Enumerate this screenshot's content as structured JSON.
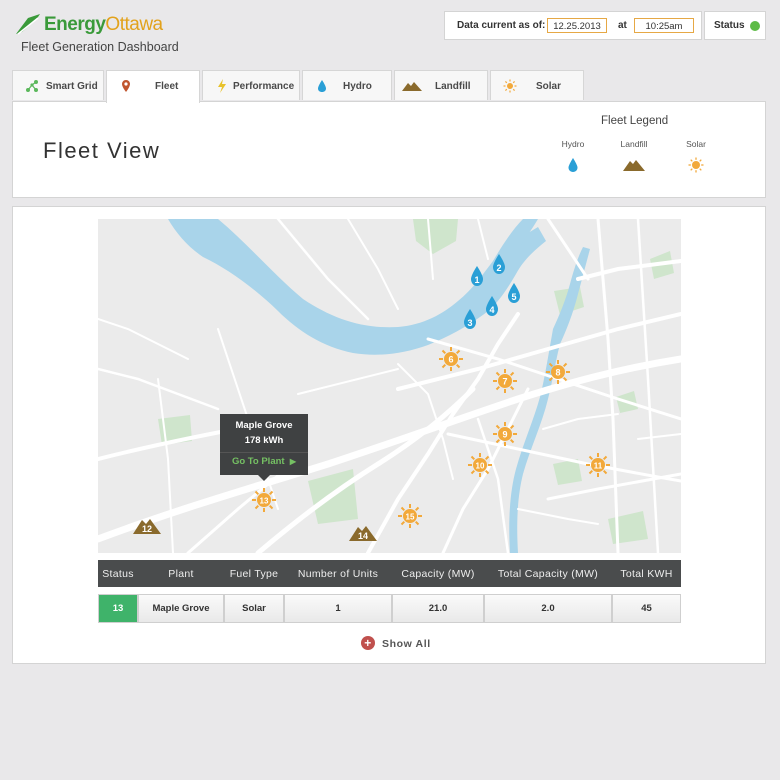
{
  "brand": {
    "name_part1": "Energy",
    "name_part2": "Ottawa",
    "subtitle": "Fleet Generation Dashboard"
  },
  "header": {
    "data_current_label": "Data current as of:",
    "date": "12.25.2013",
    "at_label": "at",
    "time": "10:25am",
    "status_label": "Status",
    "status_color": "#5dbb46"
  },
  "tabs": [
    {
      "label": "Smart Grid",
      "icon": "network-icon"
    },
    {
      "label": "Fleet",
      "icon": "map-pin-icon"
    },
    {
      "label": "Performance",
      "icon": "lightning-icon"
    },
    {
      "label": "Hydro",
      "icon": "water-drop-icon"
    },
    {
      "label": "Landfill",
      "icon": "mound-icon"
    },
    {
      "label": "Solar",
      "icon": "sun-icon"
    }
  ],
  "active_tab": "Fleet",
  "fleet": {
    "title": "Fleet View",
    "legend_title": "Fleet Legend",
    "legend": [
      {
        "label": "Hydro"
      },
      {
        "label": "Landfill"
      },
      {
        "label": "Solar"
      }
    ]
  },
  "map": {
    "markers": [
      {
        "label": "1",
        "type": "hydro"
      },
      {
        "label": "2",
        "type": "hydro"
      },
      {
        "label": "3",
        "type": "hydro"
      },
      {
        "label": "4",
        "type": "hydro"
      },
      {
        "label": "5",
        "type": "hydro"
      },
      {
        "label": "6",
        "type": "solar"
      },
      {
        "label": "7",
        "type": "solar"
      },
      {
        "label": "8",
        "type": "solar"
      },
      {
        "label": "9",
        "type": "solar"
      },
      {
        "label": "10",
        "type": "solar"
      },
      {
        "label": "11",
        "type": "solar"
      },
      {
        "label": "12",
        "type": "landfill"
      },
      {
        "label": "13",
        "type": "solar"
      },
      {
        "label": "14",
        "type": "landfill"
      },
      {
        "label": "15",
        "type": "solar"
      }
    ],
    "tooltip": {
      "name": "Maple Grove",
      "value": "178 kWh",
      "action": "Go To Plant"
    }
  },
  "table": {
    "headers": [
      "Status",
      "Plant",
      "Fuel Type",
      "Number of Units",
      "Capacity (MW)",
      "Total Capacity (MW)",
      "Total KWH"
    ],
    "rows": [
      [
        "13",
        "Maple Grove",
        "Solar",
        "1",
        "21.0",
        "2.0",
        "45"
      ]
    ]
  },
  "show_all": "Show All",
  "colors": {
    "hydro": "#2a9fd6",
    "solar": "#f2a93b",
    "landfill": "#8a6a2c",
    "status_green": "#3fb36a",
    "accent": "#e2a21c"
  }
}
